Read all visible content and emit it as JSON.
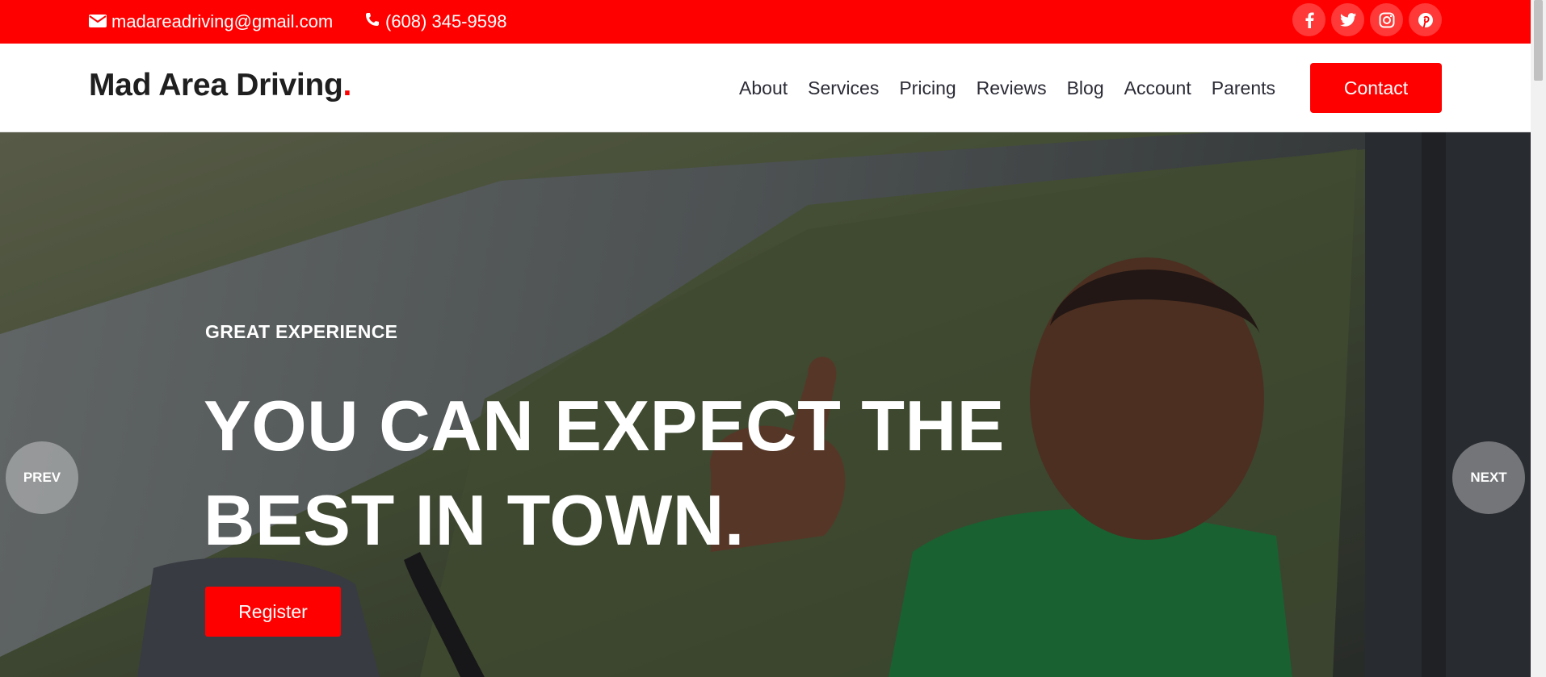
{
  "topbar": {
    "email": "madareadriving@gmail.com",
    "phone": "(608) 345-9598",
    "email_icon": "envelope-icon",
    "phone_icon": "phone-icon",
    "socials": [
      "facebook-icon",
      "twitter-icon",
      "instagram-icon",
      "pinterest-icon"
    ]
  },
  "header": {
    "logo_text": "Mad Area Driving",
    "logo_dot": ".",
    "nav": [
      "About",
      "Services",
      "Pricing",
      "Reviews",
      "Blog",
      "Account",
      "Parents"
    ],
    "contact_label": "Contact"
  },
  "hero": {
    "eyebrow": "GREAT EXPERIENCE",
    "headline_line1": "YOU CAN EXPECT THE",
    "headline_line2": "BEST IN TOWN.",
    "register_label": "Register",
    "prev_label": "PREV",
    "next_label": "NEXT"
  },
  "colors": {
    "brand_red": "#ff0000",
    "text_dark": "#1f1f1f",
    "white": "#ffffff"
  }
}
